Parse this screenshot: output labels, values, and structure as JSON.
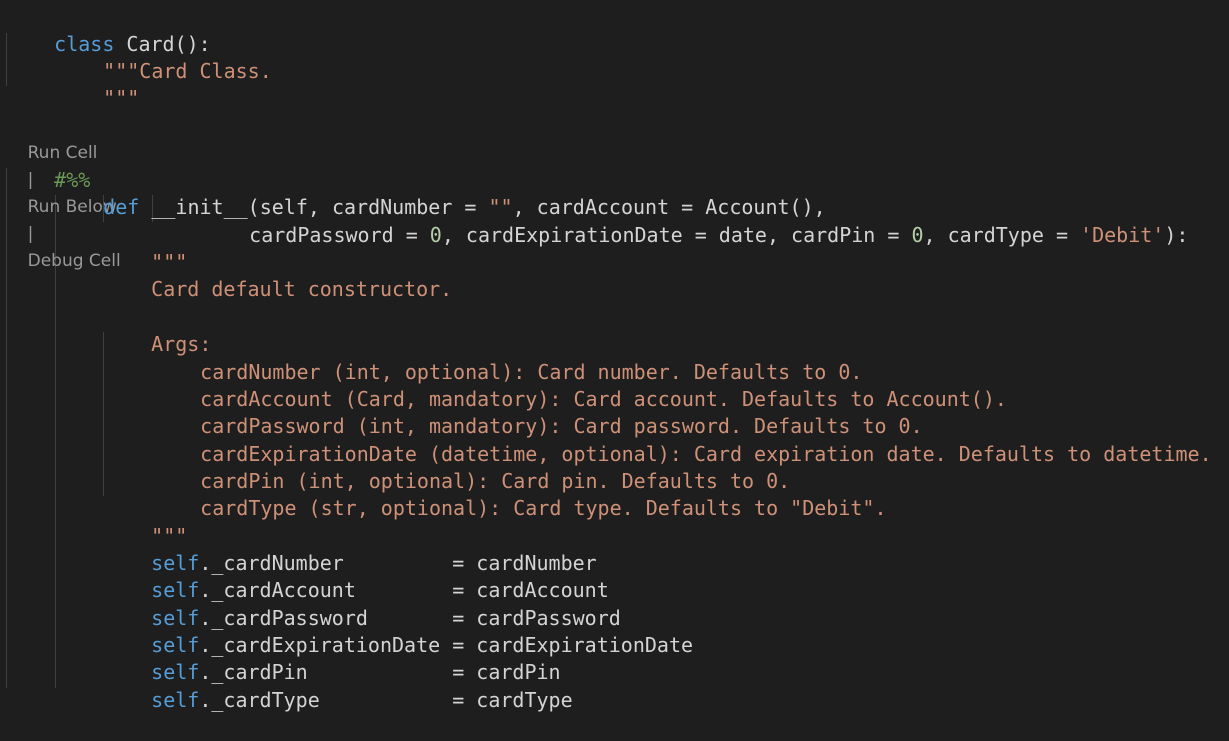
{
  "colors": {
    "background": "#1e1e1e",
    "keyword": "#569cd6",
    "string": "#ce9178",
    "number": "#b5cea8",
    "comment": "#6a9955",
    "text": "#d4d4d4",
    "codelens": "#999999"
  },
  "code": {
    "l1": {
      "kw": "class",
      "rest": " Card():"
    },
    "l2": "\"\"\"Card Class.",
    "l3": "\"\"\"",
    "codelens": {
      "run_cell": "Run Cell",
      "run_below": "Run Below",
      "debug_cell": "Debug Cell",
      "separator": "|"
    },
    "l4": "#%%",
    "l5": {
      "kw": "def",
      "a": " __init__(self, cardNumber = ",
      "s1": "\"\"",
      "b": ", cardAccount = Account(),"
    },
    "l6": {
      "a": "cardPassword = ",
      "n1": "0",
      "b": ", cardExpirationDate = date, cardPin = ",
      "n2": "0",
      "c": ", cardType = ",
      "s1": "'Debit'",
      "d": "):"
    },
    "l7": "\"\"\"",
    "l8": "Card default constructor.",
    "l9": "Args:",
    "l10": "cardNumber (int, optional): Card number. Defaults to 0.",
    "l11": "cardAccount (Card, mandatory): Card account. Defaults to Account().",
    "l12": "cardPassword (int, mandatory): Card password. Defaults to 0.",
    "l13": "cardExpirationDate (datetime, optional): Card expiration date. Defaults to datetime.",
    "l14": "cardPin (int, optional): Card pin. Defaults to 0.",
    "l15": "cardType (str, optional): Card type. Defaults to \"Debit\".",
    "l16": "\"\"\"",
    "assign": [
      {
        "self": "self",
        "attr": "._cardNumber         = cardNumber"
      },
      {
        "self": "self",
        "attr": "._cardAccount        = cardAccount"
      },
      {
        "self": "self",
        "attr": "._cardPassword       = cardPassword"
      },
      {
        "self": "self",
        "attr": "._cardExpirationDate = cardExpirationDate"
      },
      {
        "self": "self",
        "attr": "._cardPin            = cardPin"
      },
      {
        "self": "self",
        "attr": "._cardType           = cardType"
      }
    ]
  }
}
